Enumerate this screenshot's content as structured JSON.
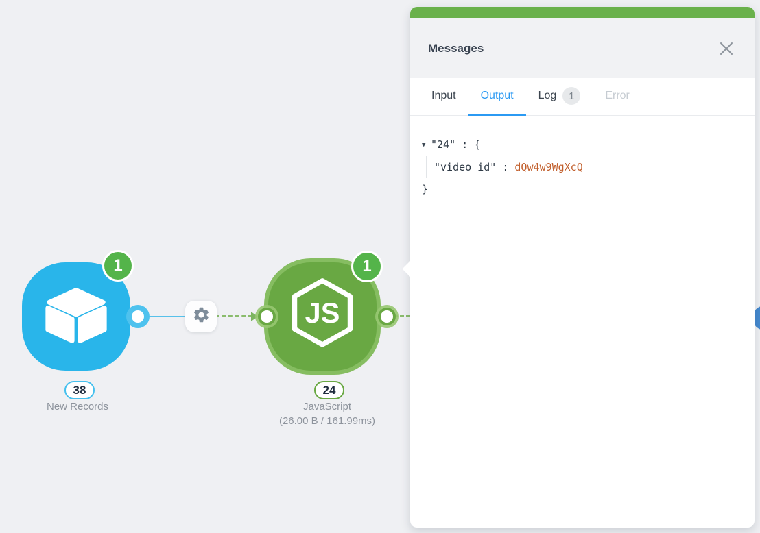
{
  "canvas": {
    "nodes": [
      {
        "id": "new-records",
        "badge": "1",
        "count": "38",
        "label": "New Records"
      },
      {
        "id": "javascript",
        "badge": "1",
        "count": "24",
        "label": "JavaScript",
        "stats": "(26.00 B / 161.99ms)"
      }
    ]
  },
  "panel": {
    "title": "Messages",
    "tabs": [
      {
        "label": "Input"
      },
      {
        "label": "Output"
      },
      {
        "label": "Log",
        "badge": "1"
      },
      {
        "label": "Error"
      }
    ],
    "output": {
      "caret": "▼",
      "root_key": "\"24\"",
      "root_open": " : {",
      "child_key": "\"video_id\"",
      "child_sep": " : ",
      "child_value": "dQw4w9WgXcQ",
      "close_brace": "}"
    }
  },
  "icons": {
    "close": "✕",
    "gear": "⚙",
    "caret_down": "▼"
  },
  "colors": {
    "canvas_bg": "#eff0f3",
    "panel_accent_green": "#6ab14b",
    "active_tab_blue": "#2b9af3",
    "node_blue": "#29b5ea",
    "node_green": "#69a843",
    "badge_green": "#54b44a",
    "json_value_orange": "#c2602e"
  }
}
